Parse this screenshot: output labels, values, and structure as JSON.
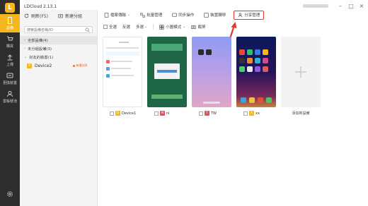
{
  "app": {
    "title": "LDCloud 2.13.1"
  },
  "rail": {
    "items": [
      {
        "label": "設備",
        "icon": "device-icon",
        "active": true
      },
      {
        "label": "購買",
        "icon": "cart-icon"
      },
      {
        "label": "上傳",
        "icon": "upload-icon"
      },
      {
        "label": "更換裝置",
        "icon": "swap-icon"
      },
      {
        "label": "雲帳號池",
        "icon": "cloud-user-icon"
      }
    ]
  },
  "groups": {
    "refresh_label": "刷新(F5)",
    "new_group_label": "新建分組",
    "search_placeholder": "搜索設備名稱/ID",
    "list": [
      {
        "label": "全部設備(4)",
        "selected": true
      },
      {
        "label": "未分組設備(3)"
      },
      {
        "label": "好友的裝置(1)"
      }
    ],
    "friend_device": {
      "name": "Device2",
      "status": "無權訪問"
    }
  },
  "toolbar": {
    "items": [
      {
        "label": "檔案傳輸"
      },
      {
        "label": "批量管理"
      },
      {
        "label": "同步操作"
      },
      {
        "label": "裝置轉移"
      },
      {
        "label": "分享管理",
        "highlight": true
      }
    ]
  },
  "toolbar2": {
    "select_all": "全選",
    "invert": "反選",
    "multi_select": "多選",
    "view_mode": "小圖模式",
    "screenshot": "截屏"
  },
  "devices": [
    {
      "name": "Device1",
      "badge": "D",
      "badge_color": "#f5b81c"
    },
    {
      "name": "ni",
      "badge": "N",
      "badge_color": "#e6505e"
    },
    {
      "name": "TW",
      "badge": "T",
      "badge_color": "#e6505e"
    },
    {
      "name": "xx",
      "badge": "X",
      "badge_color": "#f5b81c"
    }
  ],
  "add_device_label": "添加新設備",
  "colors": {
    "accent": "#f5b81c",
    "highlight": "#e03a2b"
  }
}
